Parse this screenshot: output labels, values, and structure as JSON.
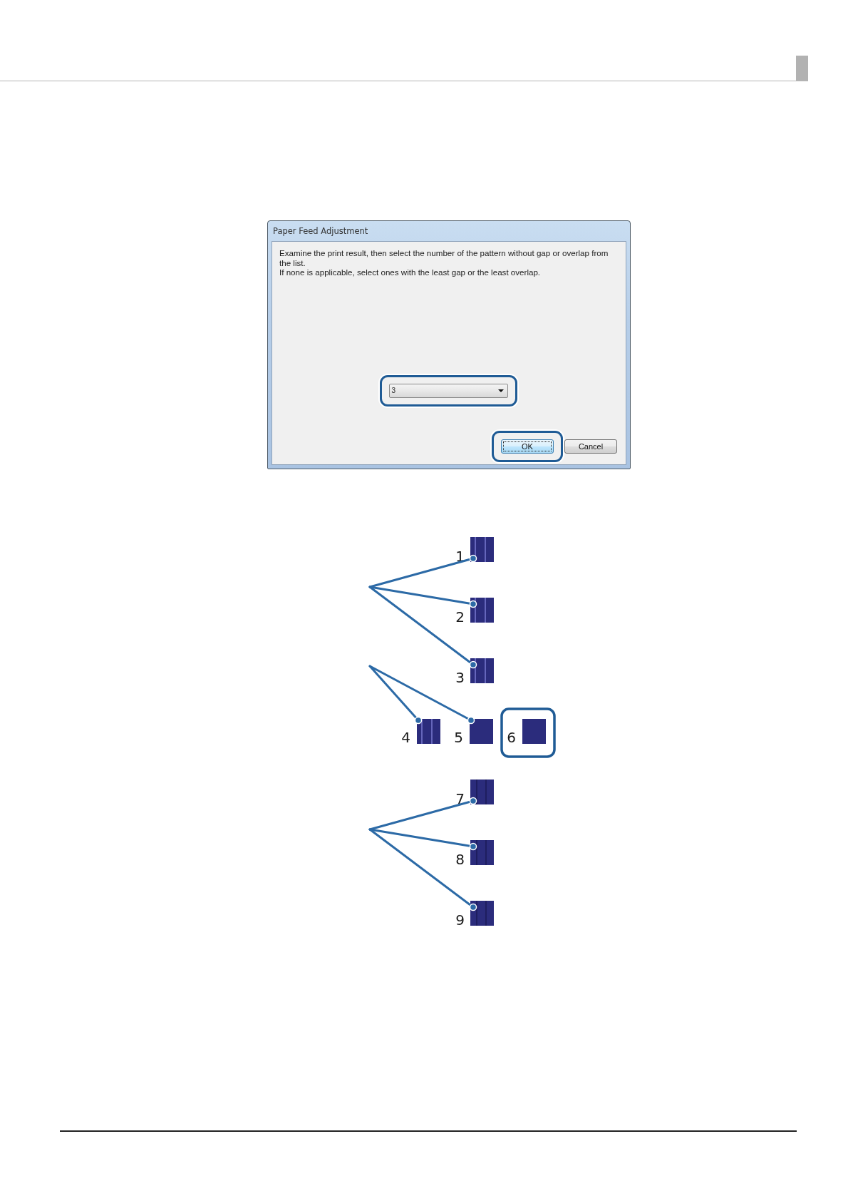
{
  "dialog": {
    "title": "Paper Feed Adjustment",
    "message": [
      "Examine the print result, then select the number of the pattern without gap or overlap from the list.",
      "If none is applicable, select ones with the least gap or the least overlap."
    ],
    "dropdown": {
      "value": "3",
      "highlighted": true
    },
    "buttons": [
      {
        "label": "OK",
        "default": true,
        "highlighted": true
      },
      {
        "label": "Cancel",
        "default": false,
        "highlighted": false
      }
    ]
  },
  "figure": {
    "groups": [
      {
        "kind": "column",
        "patterns": [
          {
            "label": "1",
            "kind": "gapped",
            "leader": true,
            "highlighted": false
          },
          {
            "label": "2",
            "kind": "gapped",
            "leader": true,
            "highlighted": false
          },
          {
            "label": "3",
            "kind": "gapped",
            "leader": true,
            "highlighted": false
          }
        ]
      },
      {
        "kind": "row",
        "patterns": [
          {
            "label": "4",
            "kind": "gapped",
            "leader": true,
            "highlighted": false
          },
          {
            "label": "5",
            "kind": "plain",
            "leader": true,
            "highlighted": false
          },
          {
            "label": "6",
            "kind": "plain",
            "leader": false,
            "highlighted": true
          }
        ]
      },
      {
        "kind": "column",
        "patterns": [
          {
            "label": "7",
            "kind": "overlapped",
            "leader": true,
            "highlighted": false
          },
          {
            "label": "8",
            "kind": "overlapped",
            "leader": true,
            "highlighted": false
          },
          {
            "label": "9",
            "kind": "overlapped",
            "leader": true,
            "highlighted": false
          }
        ]
      }
    ]
  }
}
